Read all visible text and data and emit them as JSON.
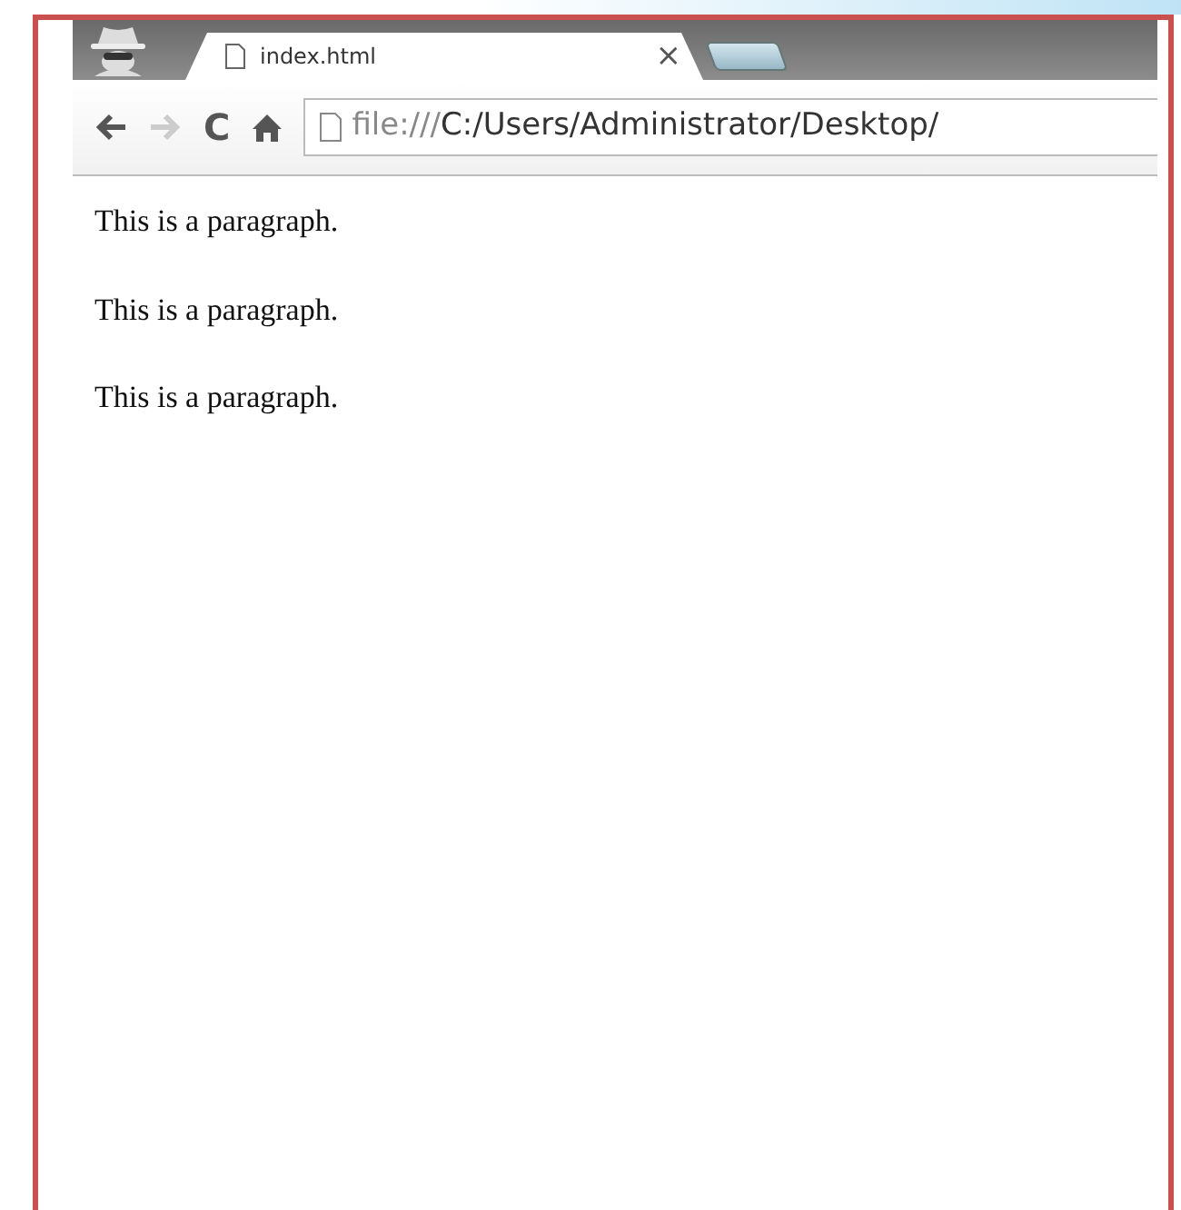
{
  "tabs": [
    {
      "title": "index.html",
      "selected": true,
      "close": "×"
    }
  ],
  "toolbar": {
    "back_disabled": false,
    "forward_disabled": true,
    "reload": "C"
  },
  "address_bar": {
    "scheme": "file:///",
    "path": "C:/Users/Administrator/Desktop/"
  },
  "page": {
    "paragraphs": [
      "This is a paragraph.",
      "This is a paragraph.",
      "This is a paragraph."
    ]
  }
}
